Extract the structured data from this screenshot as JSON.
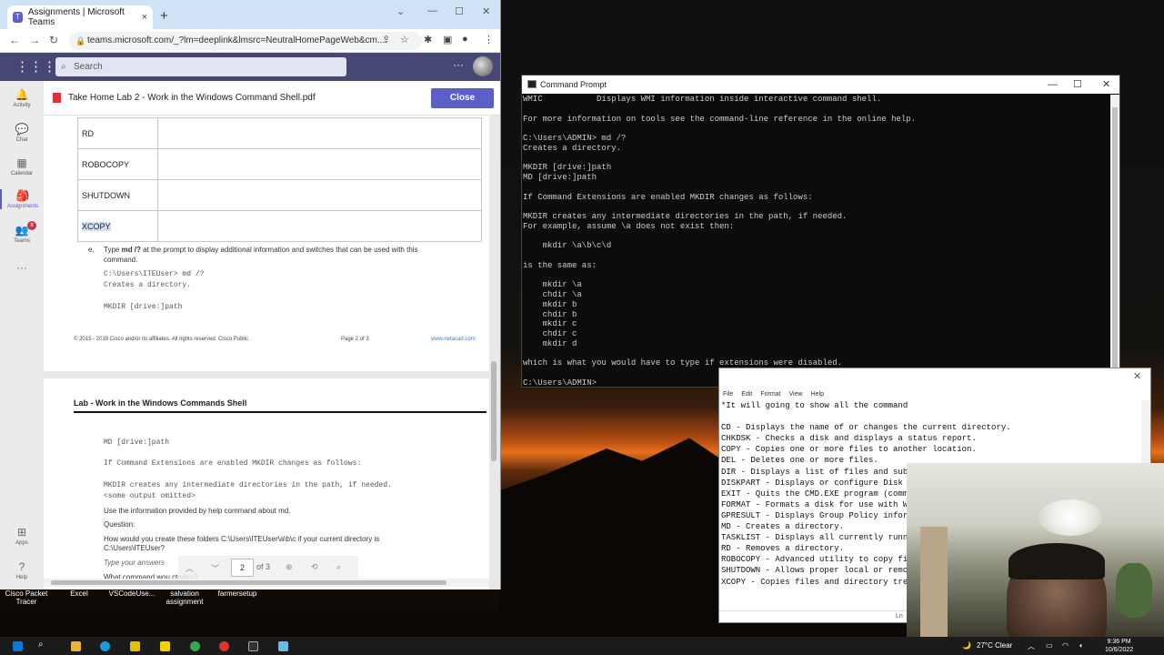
{
  "browser": {
    "tab_title": "Assignments | Microsoft Teams",
    "url": "teams.microsoft.com/_?lm=deeplink&lmsrc=NeutralHomePageWeb&cm..."
  },
  "teams": {
    "search_placeholder": "Search",
    "rail": [
      "Activity",
      "Chat",
      "Calendar",
      "Assignments",
      "Teams",
      "Apps",
      "Help"
    ],
    "teams_badge": "8"
  },
  "document": {
    "title": "Take Home Lab 2 - Work in the Windows Command Shell.pdf",
    "close_label": "Close",
    "table_rows": [
      "RD",
      "ROBOCOPY",
      "SHUTDOWN",
      "XCOPY"
    ],
    "step_e_letter": "e.",
    "step_e_line1_pre": "Type ",
    "step_e_cmd": "md /?",
    "step_e_line1_post": " at the prompt to display additional information and switches that can be used with this",
    "step_e_line2": "command.",
    "code1": "C:\\Users\\ITEUser> md /?",
    "code2": "Creates a directory.",
    "code3": "MKDIR [drive:]path",
    "footer_left": "© 2015 - 2019 Cisco and/or its affiliates. All rights reserved. Cisco Public",
    "footer_page": "Page 2 of 3",
    "footer_right": "www.netacad.com",
    "lab_heading": "Lab - Work in the Windows Commands Shell",
    "p2_code1": "MD [drive:]path",
    "p2_code2": "If Command Extensions are enabled MKDIR changes as follows:",
    "p2_code3": "MKDIR creates any intermediate directories in the path, if needed.",
    "p2_code4": "<some output omitted>",
    "p2_line_info": "Use the information provided by help command about md.",
    "p2_question": "Question:",
    "p2_q_line1": "How would you create these folders C:\\Users\\ITEUser\\a\\b\\c if your current directory is",
    "p2_q_line2": "C:\\Users\\ITEUser?",
    "p2_answer_placeholder": "Type your answers",
    "p2_cut_line": "What command wou                                                           ctories?",
    "pager_page": "2",
    "pager_of": "of 3"
  },
  "cmd": {
    "title": "Command Prompt",
    "lines": [
      "WMIC           Displays WMI information inside interactive command shell.",
      "",
      "For more information on tools see the command-line reference in the online help.",
      "",
      "C:\\Users\\ADMIN> md /?",
      "Creates a directory.",
      "",
      "MKDIR [drive:]path",
      "MD [drive:]path",
      "",
      "If Command Extensions are enabled MKDIR changes as follows:",
      "",
      "MKDIR creates any intermediate directories in the path, if needed.",
      "For example, assume \\a does not exist then:",
      "",
      "    mkdir \\a\\b\\c\\d",
      "",
      "is the same as:",
      "",
      "    mkdir \\a",
      "    chdir \\a",
      "    mkdir b",
      "    chdir b",
      "    mkdir c",
      "    chdir c",
      "    mkdir d",
      "",
      "which is what you would have to type if extensions were disabled.",
      "",
      "C:\\Users\\ADMIN>"
    ]
  },
  "notepad": {
    "menu": [
      "File",
      "Edit",
      "Format",
      "View",
      "Help"
    ],
    "lines": [
      "*It will going to show all the command",
      "",
      "CD - Displays the name of or changes the current directory.",
      "CHKDSK - Checks a disk and displays a status report.",
      "COPY - Copies one or more files to another location.",
      "DEL - Deletes one or more files.",
      "DIR - Displays a list of files and sub",
      "DISKPART - Displays or configure Disk",
      "EXIT - Quits the CMD.EXE program (comm",
      "FORMAT - Formats a disk for use with W",
      "GPRESULT - Displays Group Policy infor",
      "MD - Creates a directory.",
      "TASKLIST - Displays all currently runn",
      "RD - Removes a directory.",
      "ROBOCOPY - Advanced utility to copy fi",
      "SHUTDOWN - Allows proper local or remo",
      "XCOPY - Copies files and directory tre"
    ],
    "status": "Ln"
  },
  "desktop": {
    "icons": [
      {
        "line1": "Cisco Packet",
        "line2": "Tracer"
      },
      {
        "line1": "Excel",
        "line2": ""
      },
      {
        "line1": "VSCodeUse...",
        "line2": ""
      },
      {
        "line1": "salvation",
        "line2": "assignment"
      },
      {
        "line1": "farmersetup",
        "line2": ""
      }
    ]
  },
  "taskbar": {
    "weather": "27°C  Clear",
    "time": "9:36 PM",
    "date": "10/6/2022"
  },
  "colors": {
    "teams_purple": "#464775",
    "teams_accent": "#5b5fc7",
    "cmd_bg": "#0c0c0c"
  }
}
